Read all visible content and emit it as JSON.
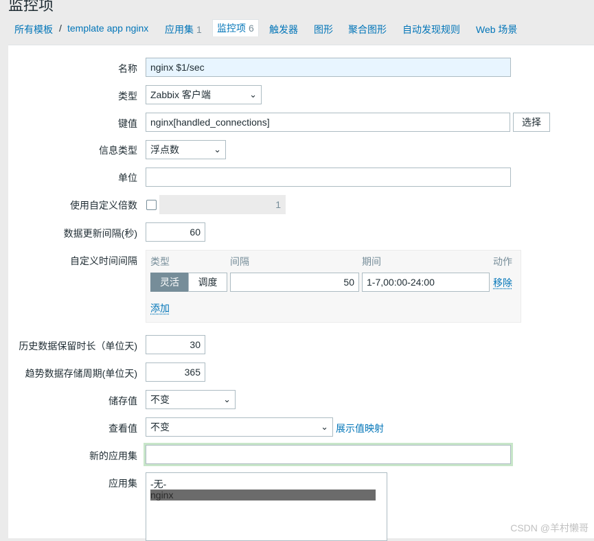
{
  "page": {
    "title": "监控项"
  },
  "nav": {
    "all_templates": "所有模板",
    "separator": "/",
    "template_name": "template app nginx",
    "applications": {
      "label": "应用集",
      "count": "1"
    },
    "items": {
      "label": "监控项",
      "count": "6"
    },
    "triggers": "触发器",
    "graphs": "图形",
    "screens": "聚合图形",
    "discovery": "自动发现规则",
    "web": "Web 场景"
  },
  "form": {
    "name": {
      "label": "名称",
      "value": "nginx $1/sec"
    },
    "type": {
      "label": "类型",
      "value": "Zabbix 客户端"
    },
    "key": {
      "label": "键值",
      "value": "nginx[handled_connections]",
      "button": "选择"
    },
    "info_type": {
      "label": "信息类型",
      "value": "浮点数"
    },
    "units": {
      "label": "单位",
      "value": ""
    },
    "multiplier": {
      "label": "使用自定义倍数",
      "checked": false,
      "value": "1"
    },
    "update_interval": {
      "label": "数据更新间隔(秒)",
      "value": "60"
    },
    "custom_intervals": {
      "label": "自定义时间间隔",
      "headers": {
        "type": "类型",
        "interval": "间隔",
        "period": "期间",
        "action": "动作"
      },
      "row": {
        "flexible": "灵活",
        "scheduling": "调度",
        "interval": "50",
        "period": "1-7,00:00-24:00",
        "remove": "移除"
      },
      "add": "添加"
    },
    "history": {
      "label": "历史数据保留时长（单位天)",
      "value": "30"
    },
    "trends": {
      "label": "趋势数据存储周期(单位天)",
      "value": "365"
    },
    "store_value": {
      "label": "储存值",
      "value": "不变"
    },
    "show_value": {
      "label": "查看值",
      "value": "不变",
      "link": "展示值映射"
    },
    "new_application": {
      "label": "新的应用集",
      "value": ""
    },
    "applications": {
      "label": "应用集",
      "options": [
        "-无-",
        "nginx"
      ],
      "selected": "nginx"
    }
  },
  "watermark": "CSDN @羊村懒哥",
  "colors": {
    "link": "#0275b8",
    "focus_bg": "#e8f5ff",
    "segment_active": "#768d99",
    "focus_ring": "#c8e6c9"
  }
}
